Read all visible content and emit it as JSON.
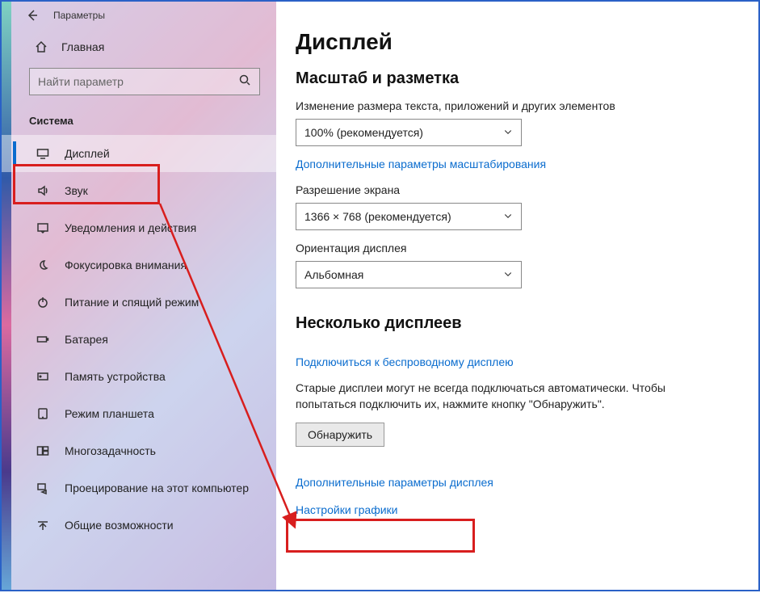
{
  "window": {
    "title": "Параметры"
  },
  "sidebar": {
    "home": "Главная",
    "search_placeholder": "Найти параметр",
    "section": "Система",
    "items": [
      {
        "label": "Дисплей"
      },
      {
        "label": "Звук"
      },
      {
        "label": "Уведомления и действия"
      },
      {
        "label": "Фокусировка внимания"
      },
      {
        "label": "Питание и спящий режим"
      },
      {
        "label": "Батарея"
      },
      {
        "label": "Память устройства"
      },
      {
        "label": "Режим планшета"
      },
      {
        "label": "Многозадачность"
      },
      {
        "label": "Проецирование на этот компьютер"
      },
      {
        "label": "Общие возможности"
      }
    ]
  },
  "main": {
    "title": "Дисплей",
    "scale": {
      "heading": "Масштаб и разметка",
      "label_scale": "Изменение размера текста, приложений и других элементов",
      "value_scale": "100% (рекомендуется)",
      "advanced_link": "Дополнительные параметры масштабирования",
      "label_resolution": "Разрешение экрана",
      "value_resolution": "1366 × 768 (рекомендуется)",
      "label_orientation": "Ориентация дисплея",
      "value_orientation": "Альбомная"
    },
    "multi": {
      "heading": "Несколько дисплеев",
      "connect_link": "Подключиться к беспроводному дисплею",
      "help_text": "Старые дисплеи могут не всегда подключаться автоматически. Чтобы попытаться подключить их, нажмите кнопку \"Обнаружить\".",
      "detect_btn": "Обнаружить",
      "advanced_link": "Дополнительные параметры дисплея",
      "graphics_link": "Настройки графики"
    }
  }
}
